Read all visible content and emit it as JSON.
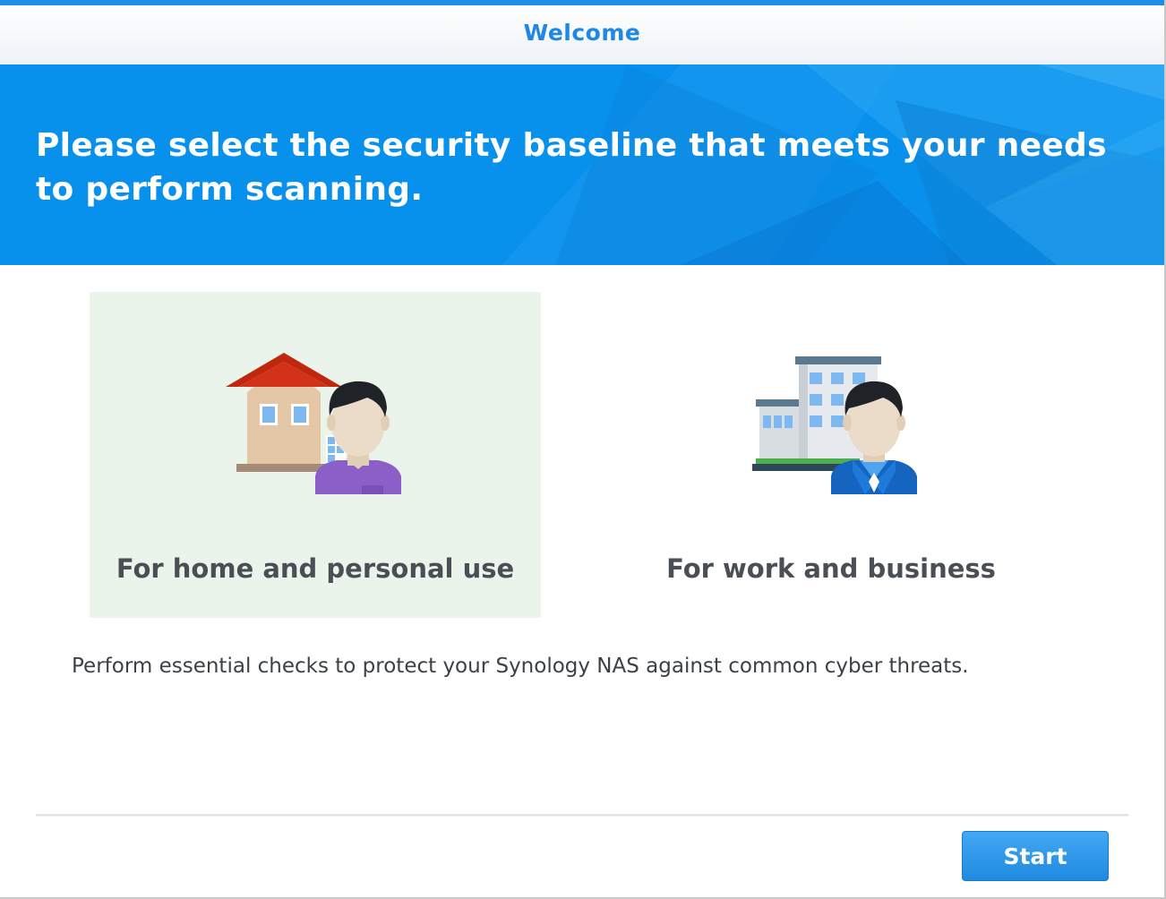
{
  "window": {
    "title": "Welcome"
  },
  "banner": {
    "headline": "Please select the security baseline that meets your needs to perform scanning."
  },
  "options": [
    {
      "label": "For home and personal use",
      "icon": "house-person-icon",
      "selected": true
    },
    {
      "label": "For work and business",
      "icon": "office-building-person-icon",
      "selected": false
    }
  ],
  "description": "Perform essential checks to protect your Synology NAS against common cyber threats.",
  "footer": {
    "start_label": "Start"
  },
  "colors": {
    "accent": "#1e88e5",
    "banner": "#0790ec",
    "selected_bg": "#eaf4ea",
    "text": "#4a4f55"
  }
}
